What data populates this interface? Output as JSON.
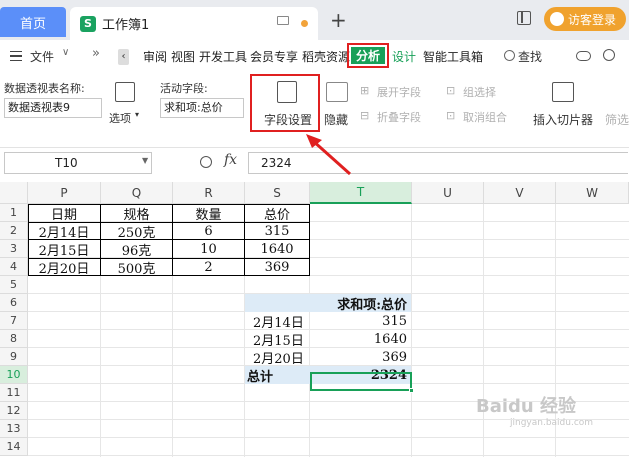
{
  "titlebar": {
    "home_tab": "首页",
    "doc_icon": "S",
    "doc_tab": "工作簿1",
    "new_tab": "+",
    "visitor_login": "访客登录"
  },
  "menu": {
    "file": "文件",
    "items": [
      "审阅",
      "视图",
      "开发工具",
      "会员专享",
      "稻壳资源"
    ],
    "analyze": "分析",
    "design": "设计",
    "smart_toolbox": "智能工具箱",
    "search": "查找"
  },
  "ribbon": {
    "pivot_name_label": "数据透视表名称:",
    "pivot_name_value": "数据透视表9",
    "options": "选项",
    "active_field_label": "活动字段:",
    "active_field_value": "求和项:总价",
    "field_settings": "字段设置",
    "hide": "隐藏",
    "expand_field": "展开字段",
    "collapse_field": "折叠字段",
    "group_selection": "组选择",
    "ungroup": "取消组合",
    "insert_slicer": "插入切片器",
    "filter": "筛选"
  },
  "formula": {
    "cell_ref": "T10",
    "fx": "fx",
    "value": "2324"
  },
  "columns": [
    "P",
    "Q",
    "R",
    "S",
    "T",
    "U",
    "V",
    "W"
  ],
  "rows": [
    "1",
    "2",
    "3",
    "4",
    "5",
    "6",
    "7",
    "8",
    "9",
    "10",
    "11",
    "12",
    "13",
    "14"
  ],
  "source_table": {
    "headers": [
      "日期",
      "规格",
      "数量",
      "总价"
    ],
    "rows": [
      [
        "2月14日",
        "250克",
        "6",
        "315"
      ],
      [
        "2月15日",
        "96克",
        "10",
        "1640"
      ],
      [
        "2月20日",
        "500克",
        "2",
        "369"
      ]
    ]
  },
  "pivot": {
    "header": "求和项:总价",
    "rows": [
      {
        "label": "2月14日",
        "value": "315"
      },
      {
        "label": "2月15日",
        "value": "1640"
      },
      {
        "label": "2月20日",
        "value": "369"
      }
    ],
    "total_label": "总计",
    "total_value": "2324"
  },
  "watermark": {
    "brand": "Baidu 经验",
    "url": "jingyan.baidu.com"
  },
  "colors": {
    "accent_green": "#18a058",
    "highlight_red": "#e02020",
    "pivot_blue": "#ddebf7"
  }
}
